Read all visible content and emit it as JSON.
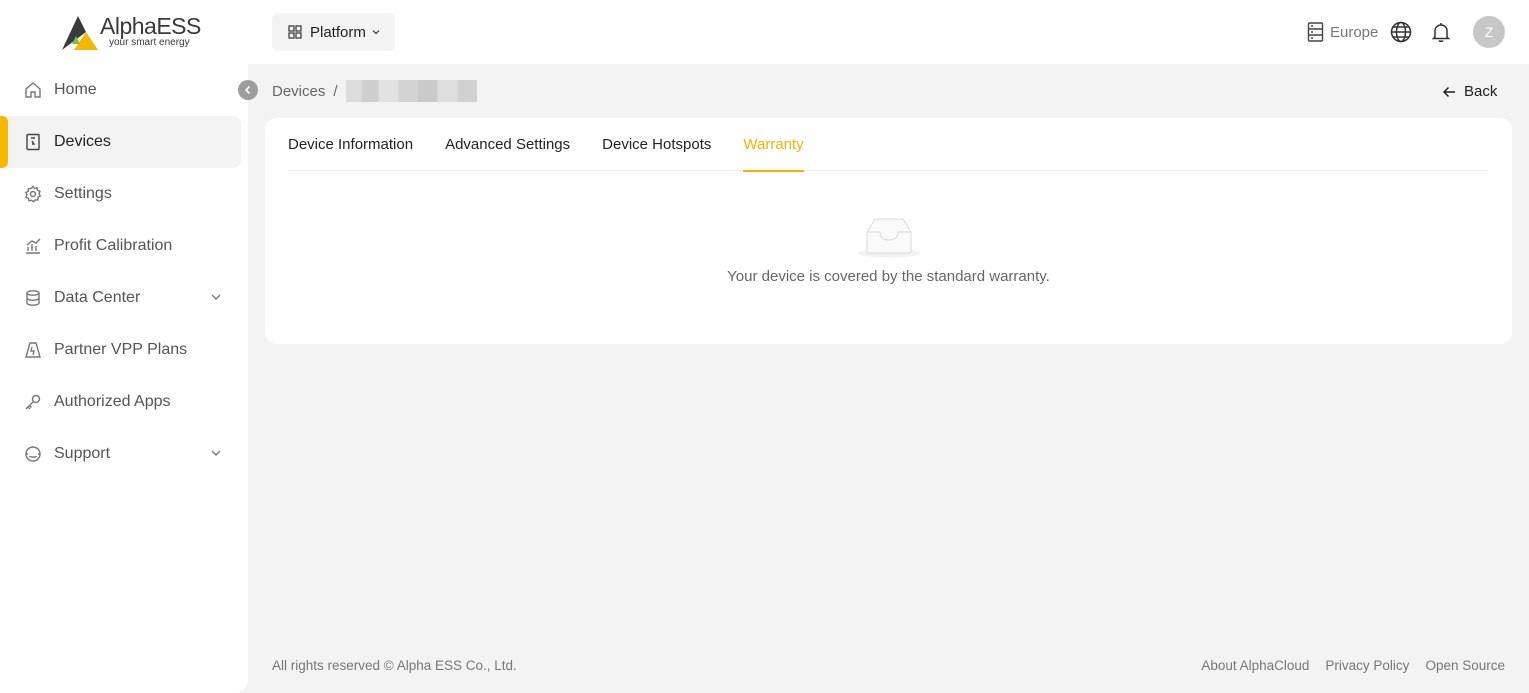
{
  "brand": {
    "name": "AlphaESS",
    "tagline": "your smart energy"
  },
  "sidebar": {
    "items": [
      {
        "label": "Home",
        "icon": "home-icon",
        "active": false
      },
      {
        "label": "Devices",
        "icon": "device-icon",
        "active": true
      },
      {
        "label": "Settings",
        "icon": "gear-icon",
        "active": false
      },
      {
        "label": "Profit Calibration",
        "icon": "chart-icon",
        "active": false
      },
      {
        "label": "Data Center",
        "icon": "database-icon",
        "active": false,
        "expandable": true
      },
      {
        "label": "Partner VPP Plans",
        "icon": "vpp-icon",
        "active": false
      },
      {
        "label": "Authorized Apps",
        "icon": "key-icon",
        "active": false
      },
      {
        "label": "Support",
        "icon": "support-icon",
        "active": false,
        "expandable": true
      }
    ]
  },
  "topbar": {
    "platform_label": "Platform",
    "region_label": "Europe",
    "avatar_initial": "Z"
  },
  "breadcrumb": {
    "root": "Devices",
    "separator": "/"
  },
  "back_label": "Back",
  "tabs": [
    {
      "label": "Device Information",
      "active": false
    },
    {
      "label": "Advanced Settings",
      "active": false
    },
    {
      "label": "Device Hotspots",
      "active": false
    },
    {
      "label": "Warranty",
      "active": true
    }
  ],
  "empty_state": {
    "text": "Your device is covered by the standard warranty.",
    "icon": "empty-inbox-icon"
  },
  "footer": {
    "copyright": "All rights reserved © Alpha ESS Co., Ltd.",
    "links": [
      "About AlphaCloud",
      "Privacy Policy",
      "Open Source"
    ]
  },
  "colors": {
    "accent": "#f0b400",
    "sidebar_active_bar": "#f5b700",
    "background": "#f3f3f3"
  }
}
